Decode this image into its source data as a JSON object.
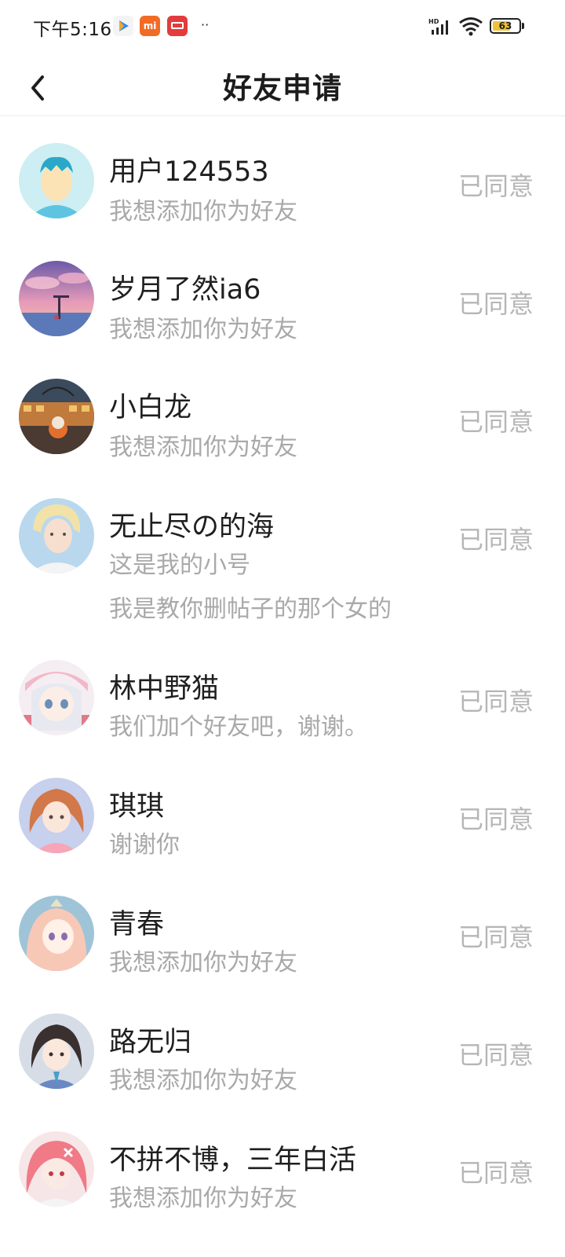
{
  "status_bar": {
    "time": "下午5:16",
    "app_mi_label": "mi",
    "dots": "··",
    "battery": "63"
  },
  "header": {
    "title": "好友申请"
  },
  "requests": [
    {
      "name": "用户124553",
      "messages": [
        "我想添加你为好友"
      ],
      "status": "已同意",
      "avatar": "default-avatar-icon"
    },
    {
      "name": "岁月了然ia6",
      "messages": [
        "我想添加你为好友"
      ],
      "status": "已同意",
      "avatar": "sunset-photo"
    },
    {
      "name": "小白龙",
      "messages": [
        "我想添加你为好友"
      ],
      "status": "已同意",
      "avatar": "astronaut-art"
    },
    {
      "name": "无止尽の的海",
      "messages": [
        "这是我的小号",
        "我是教你删帖子的那个女的"
      ],
      "status": "已同意",
      "avatar": "portrait-illustration"
    },
    {
      "name": "林中野猫",
      "messages": [
        "我们加个好友吧，谢谢。"
      ],
      "status": "已同意",
      "avatar": "anime-girl"
    },
    {
      "name": "琪琪",
      "messages": [
        "谢谢你"
      ],
      "status": "已同意",
      "avatar": "anime-girl"
    },
    {
      "name": "青春",
      "messages": [
        "我想添加你为好友"
      ],
      "status": "已同意",
      "avatar": "anime-girl"
    },
    {
      "name": "路无归",
      "messages": [
        "我想添加你为好友"
      ],
      "status": "已同意",
      "avatar": "anime-girl"
    },
    {
      "name": "不拼不博，三年白活",
      "messages": [
        "我想添加你为好友"
      ],
      "status": "已同意",
      "avatar": "anime-girl"
    }
  ],
  "colors": {
    "name_text": "#1f1f1f",
    "message_text": "#a9a9a9",
    "status_text": "#b6b6b6",
    "battery_fill": "#f0c23a"
  }
}
